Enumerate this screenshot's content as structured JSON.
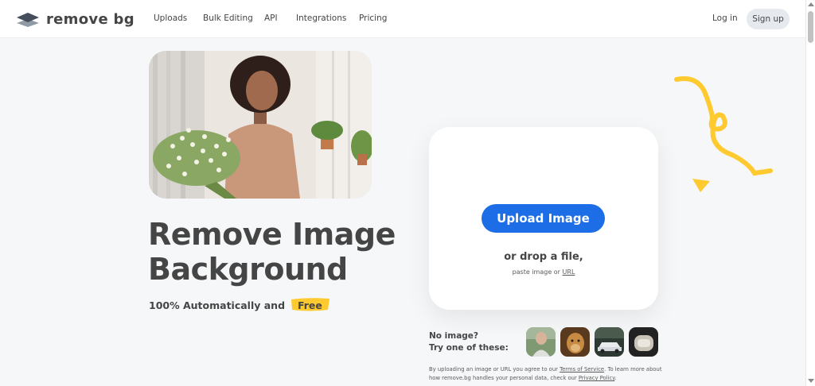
{
  "brand": {
    "name": "remove bg",
    "accent": "#1d6ee6",
    "highlight": "#ffc930"
  },
  "nav": {
    "links": [
      "Uploads",
      "Bulk Editing",
      "API",
      "Integrations",
      "Pricing"
    ],
    "login": "Log in",
    "signup": "Sign up"
  },
  "hero": {
    "title_line1": "Remove Image",
    "title_line2": "Background",
    "subtitle": "100% Automatically and",
    "free_badge": "Free"
  },
  "upload": {
    "button": "Upload Image",
    "drop_text": "or drop a file,",
    "paste_prefix": "paste image or",
    "url_link": "URL"
  },
  "samples": {
    "line1": "No image?",
    "line2": "Try one of these:",
    "items": [
      "sample-person",
      "sample-animal",
      "sample-car",
      "sample-product"
    ]
  },
  "legal": {
    "part1": "By uploading an image or URL you agree to our",
    "terms": "Terms of Service",
    "part2": ". To learn more about how remove.bg handles your personal data, check our",
    "privacy": "Privacy Policy",
    "part3": "."
  },
  "icons": {
    "logo": "stacked-layers-icon",
    "decor": [
      "squiggle-decoration",
      "triangle-decoration"
    ]
  }
}
